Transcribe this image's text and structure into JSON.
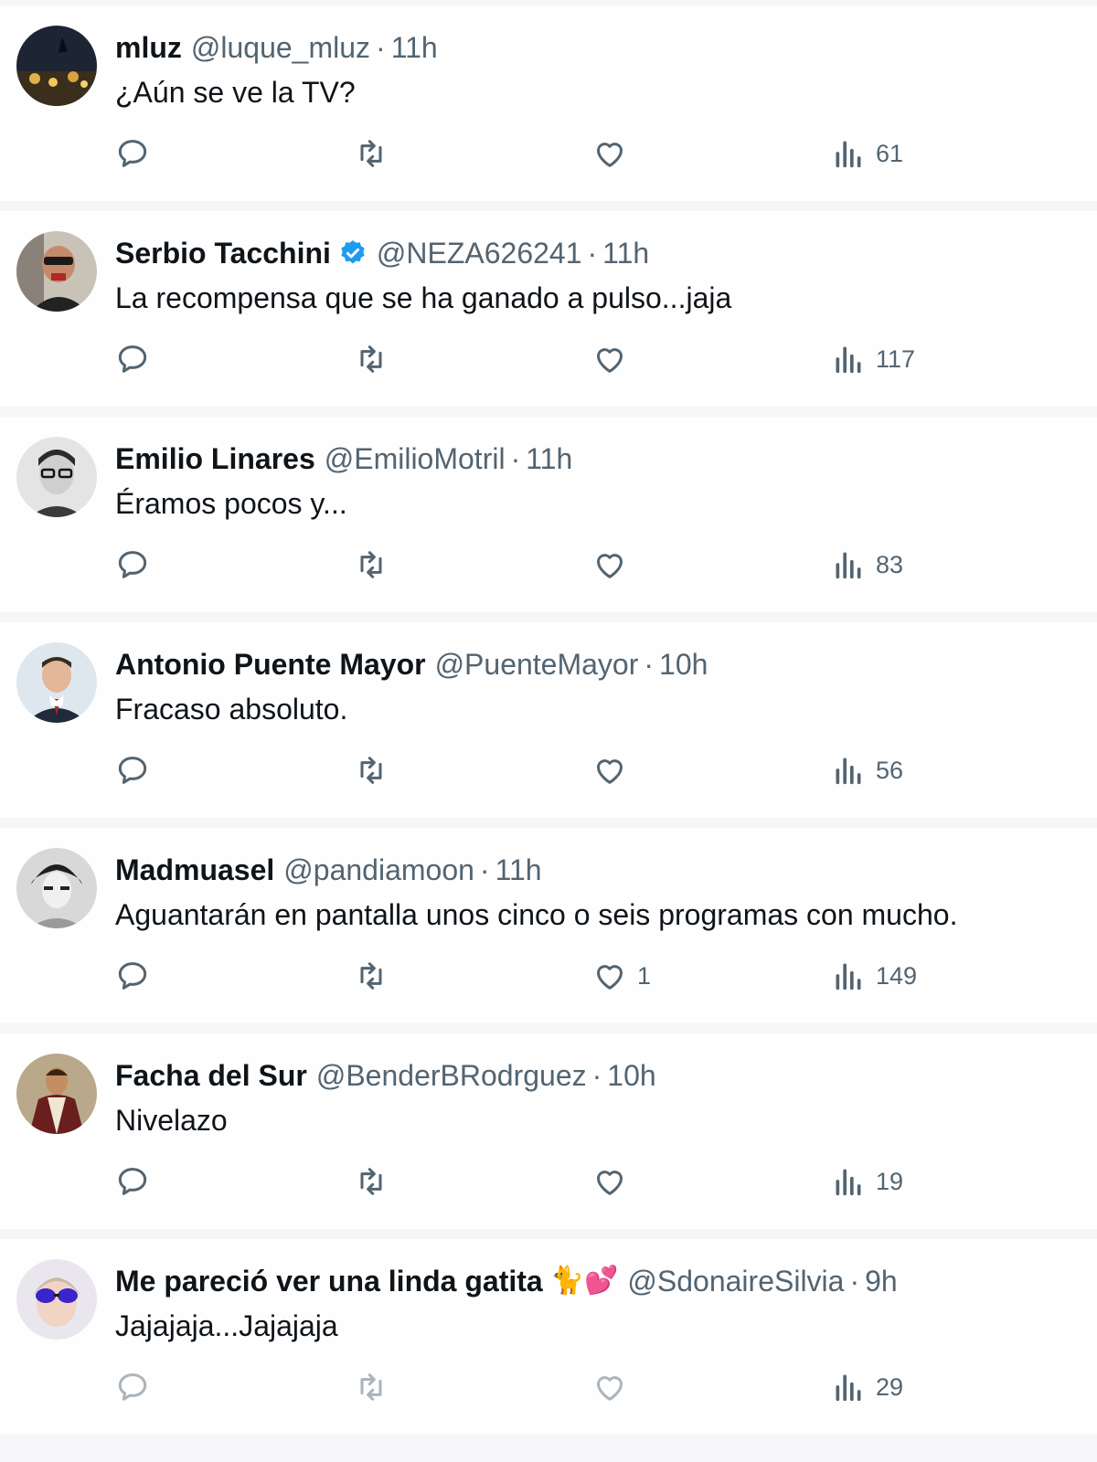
{
  "colors": {
    "text_primary": "#0f1419",
    "text_secondary": "#536471",
    "verified_blue": "#1d9bf0",
    "separator": "#f6f6f8"
  },
  "icons": {
    "reply": "speech-bubble-icon",
    "retweet": "retweet-arrows-icon",
    "like": "heart-icon",
    "views": "bar-chart-icon",
    "verified": "verified-badge-icon"
  },
  "tweets": [
    {
      "name": "mluz",
      "handle": "@luque_mluz",
      "dot": "·",
      "time": "11h",
      "text": "¿Aún se ve la TV?",
      "likes": "",
      "views": "61"
    },
    {
      "name": "Serbio Tacchini",
      "handle": "@NEZA626241",
      "dot": "·",
      "time": "11h",
      "text": "La recompensa que se ha ganado a pulso...jaja",
      "likes": "",
      "views": "117",
      "verified": true
    },
    {
      "name": "Emilio Linares",
      "handle": "@EmilioMotril",
      "dot": "·",
      "time": "11h",
      "text": "Éramos pocos y...",
      "likes": "",
      "views": "83"
    },
    {
      "name": "Antonio Puente Mayor",
      "handle": "@PuenteMayor",
      "dot": "·",
      "time": "10h",
      "text": "Fracaso absoluto.",
      "likes": "",
      "views": "56"
    },
    {
      "name": "Madmuasel",
      "handle": "@pandiamoon",
      "dot": "·",
      "time": "11h",
      "text": "Aguantarán en pantalla unos cinco o seis programas con mucho.",
      "likes": "1",
      "views": "149"
    },
    {
      "name": "Facha del Sur",
      "handle": "@BenderBRodrguez",
      "dot": "·",
      "time": "10h",
      "text": "Nivelazo",
      "likes": "",
      "views": "19"
    },
    {
      "name": "Me pareció ver una linda gatita",
      "name_emoji": "🐈💕",
      "handle": "@SdonaireSilvia",
      "dot": "·",
      "time": "9h",
      "text": "Jajajaja...Jajajaja",
      "likes": "",
      "views": "29"
    }
  ]
}
